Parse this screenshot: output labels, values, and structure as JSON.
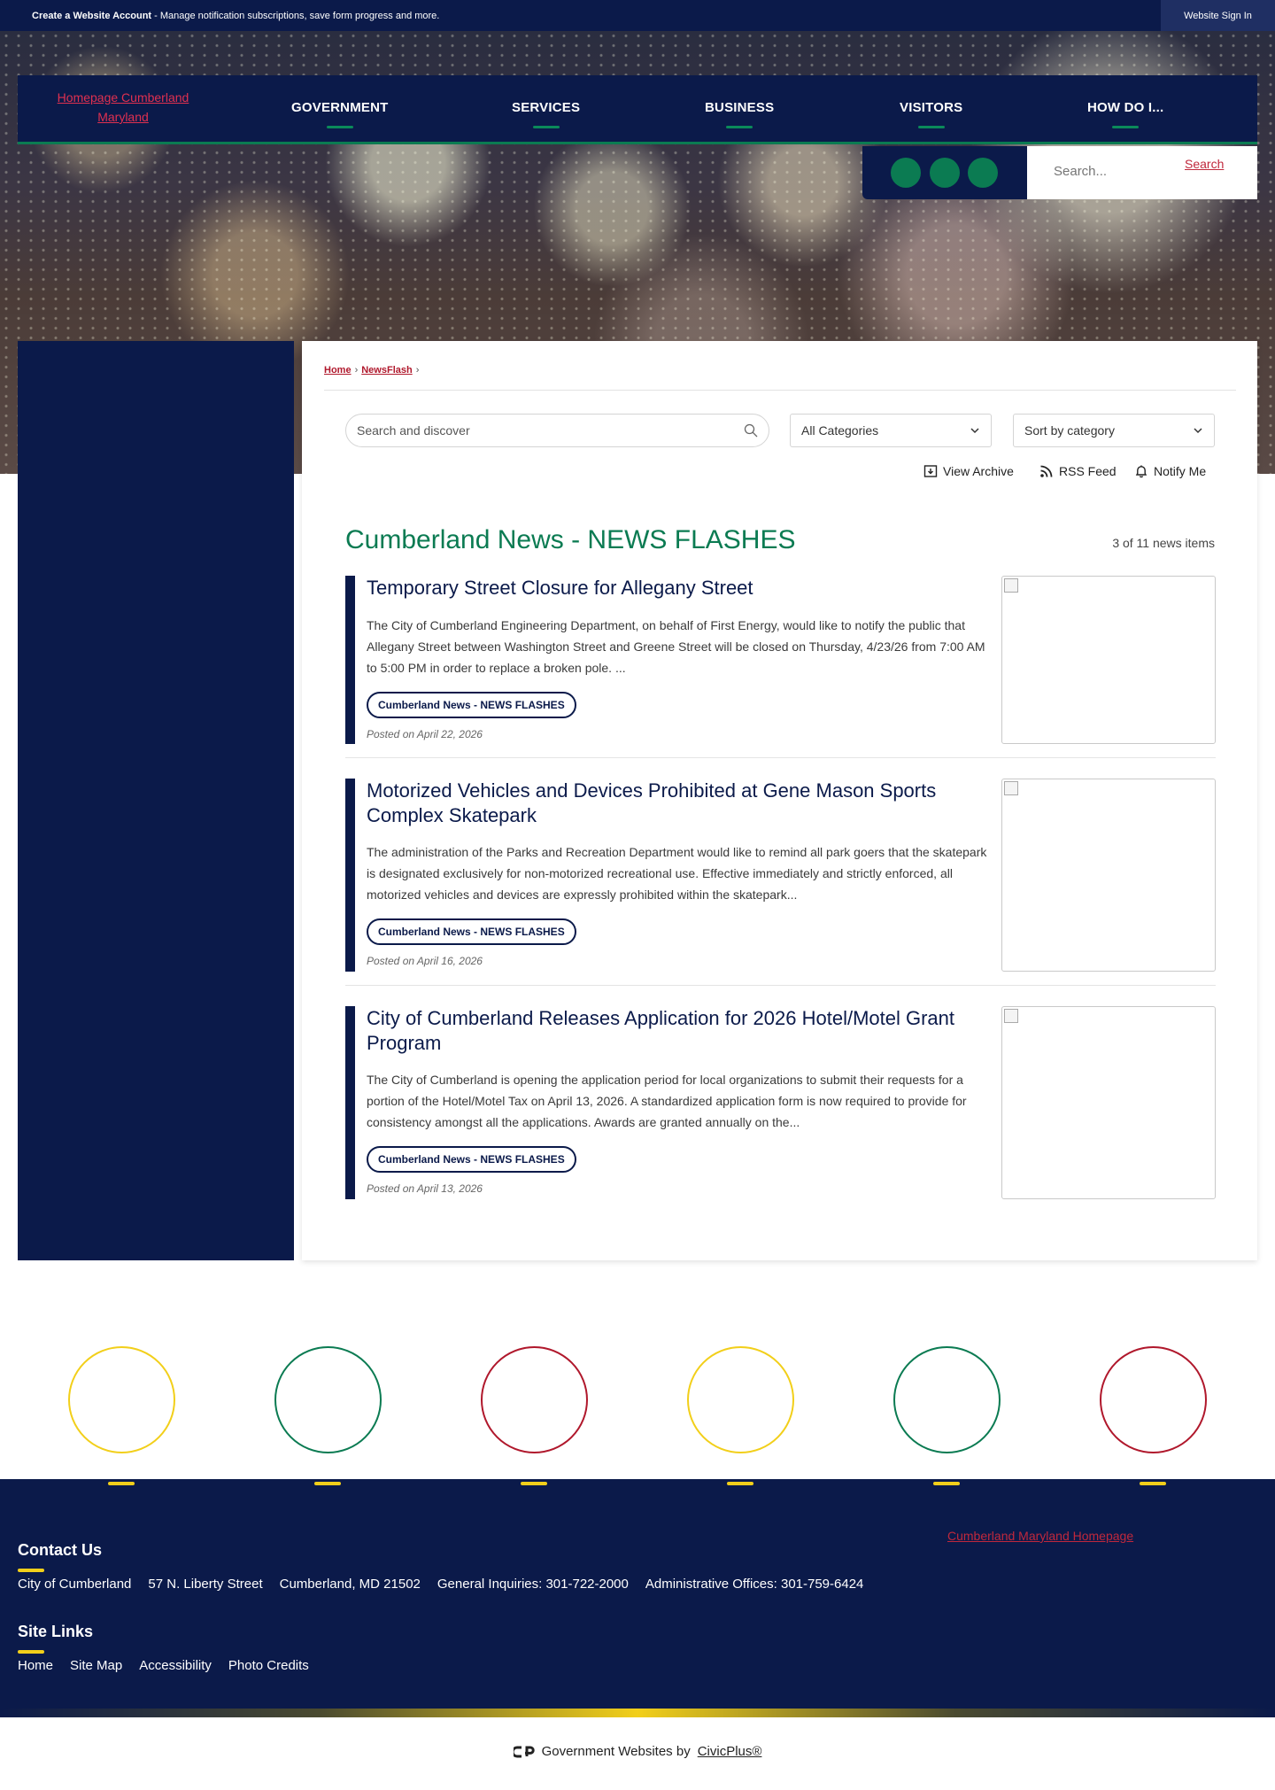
{
  "utility_bar": {
    "account_label": "Create a Website Account",
    "account_desc": " - Manage notification subscriptions, save form progress and more.",
    "signin_label": "Website Sign In"
  },
  "header": {
    "logo_alt": "Homepage Cumberland Maryland",
    "nav": [
      "GOVERNMENT",
      "SERVICES",
      "BUSINESS",
      "VISITORS",
      "HOW DO I..."
    ],
    "search_placeholder": "Search...",
    "search_button": "Search"
  },
  "breadcrumb": {
    "home": "Home",
    "current": "NewsFlash",
    "sep": "›"
  },
  "filters": {
    "search_placeholder": "Search and discover",
    "category": "All Categories",
    "sort": "Sort by category",
    "view_archive": "View Archive",
    "rss_feed": "RSS Feed",
    "notify_me": "Notify Me"
  },
  "news": {
    "heading": "Cumberland News - NEWS FLASHES",
    "count": "3 of 11 news items",
    "items": [
      {
        "title": "Temporary Street Closure for Allegany Street",
        "body": "The City of Cumberland Engineering Department, on behalf of First Energy, would like to notify the public that Allegany Street between Washington Street and Greene Street will be closed on Thursday, 4/23/26 from 7:00 AM to 5:00 PM in order to replace a broken pole. ...",
        "tag": "Cumberland News - NEWS FLASHES",
        "date": "Posted on April 22, 2026"
      },
      {
        "title": "Motorized Vehicles and Devices Prohibited at Gene Mason Sports Complex Skatepark",
        "body": "The administration of the Parks and Recreation Department would like to remind all park goers that the skatepark is designated exclusively for non-motorized recreational use. Effective immediately and strictly enforced, all motorized vehicles and devices are expressly prohibited within the skatepark...",
        "tag": "Cumberland News - NEWS FLASHES",
        "date": "Posted on April 16, 2026"
      },
      {
        "title": "City of Cumberland Releases Application for 2026 Hotel/Motel Grant Program",
        "body": "The City of Cumberland is opening the application period for local organizations to submit their requests for a portion of the Hotel/Motel Tax on April 13, 2026. A standardized application form is now required to provide for consistency amongst all the applications. Awards are granted annually on the...",
        "tag": "Cumberland News - NEWS FLASHES",
        "date": "Posted on April 13, 2026"
      }
    ]
  },
  "footer": {
    "contact_heading": "Contact Us",
    "contact": [
      "City of Cumberland",
      "57 N. Liberty Street",
      "Cumberland, MD 21502",
      "General Inquiries: 301-722-2000",
      "Administrative Offices: 301-759-6424"
    ],
    "links_heading": "Site Links",
    "links": [
      "Home",
      "Site Map",
      "Accessibility",
      "Photo Credits"
    ],
    "logo_alt": "Cumberland Maryland Homepage",
    "powered_prefix": "Government Websites by",
    "powered_link": "CivicPlus®"
  },
  "colors": {
    "navy": "#0b1a4a",
    "green": "#0b7b52",
    "gold": "#f2cf1a",
    "red": "#b0182c"
  }
}
